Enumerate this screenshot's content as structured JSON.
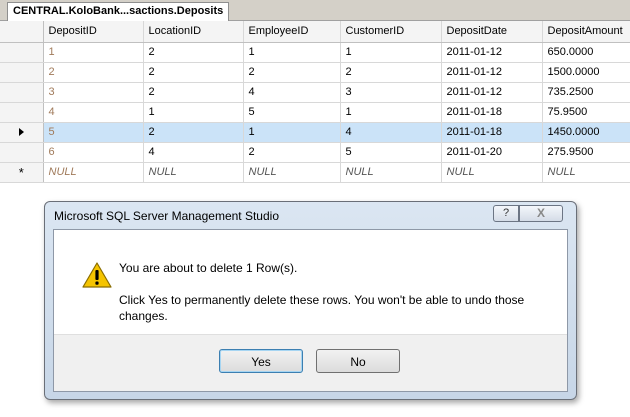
{
  "tab": {
    "title": "CENTRAL.KoloBank...sactions.Deposits"
  },
  "grid": {
    "columns": [
      "DepositID",
      "LocationID",
      "EmployeeID",
      "CustomerID",
      "DepositDate",
      "DepositAmount"
    ],
    "rows": [
      [
        "1",
        "2",
        "1",
        "1",
        "2011-01-12",
        "650.0000"
      ],
      [
        "2",
        "2",
        "2",
        "2",
        "2011-01-12",
        "1500.0000"
      ],
      [
        "3",
        "2",
        "4",
        "3",
        "2011-01-12",
        "735.2500"
      ],
      [
        "4",
        "1",
        "5",
        "1",
        "2011-01-18",
        "75.9500"
      ],
      [
        "5",
        "2",
        "1",
        "4",
        "2011-01-18",
        "1450.0000"
      ],
      [
        "6",
        "4",
        "2",
        "5",
        "2011-01-20",
        "275.9500"
      ]
    ],
    "new_row": [
      "NULL",
      "NULL",
      "NULL",
      "NULL",
      "NULL",
      "NULL"
    ],
    "new_row_marker": "*",
    "selected_row_index": 4
  },
  "dialog": {
    "title": "Microsoft SQL Server Management Studio",
    "help_label": "?",
    "close_label": "X",
    "message": "You are about to delete 1 Row(s).",
    "detail": "Click Yes to permanently delete these rows. You won't be able to undo those changes.",
    "yes_label": "Yes",
    "no_label": "No"
  },
  "colors": {
    "selected_row": "#cbe3f8",
    "id_text": "#a07a5a",
    "dialog_frame": "#c7d6e7"
  }
}
